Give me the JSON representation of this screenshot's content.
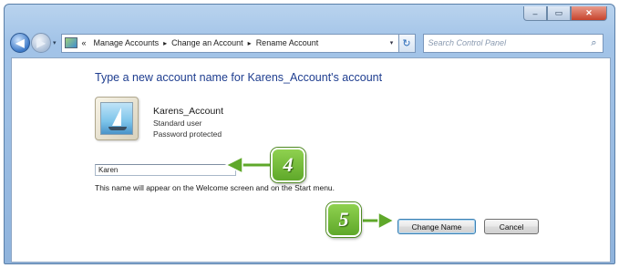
{
  "window": {
    "title_controls": {
      "minimize": "–",
      "maximize": "▭",
      "close": "✕"
    }
  },
  "navbar": {
    "back": "◀",
    "forward": "▶",
    "history_drop": "▾",
    "breadcrumb_lead": "«",
    "breadcrumbs": [
      "Manage Accounts",
      "Change an Account",
      "Rename Account"
    ],
    "separator": "▸",
    "address_drop": "▾",
    "refresh": "↻",
    "search_placeholder": "Search Control Panel",
    "search_icon": "⌕"
  },
  "content": {
    "heading": "Type a new account name for Karens_Account's account",
    "account": {
      "name": "Karens_Account",
      "type": "Standard user",
      "password_status": "Password protected"
    },
    "new_name_value": "Karen",
    "helper_text": "This name will appear on the Welcome screen and on the Start menu.",
    "buttons": {
      "change_name": "Change Name",
      "cancel": "Cancel"
    }
  },
  "callouts": {
    "step4": "4",
    "step5": "5"
  },
  "colors": {
    "callout_green": "#6db536",
    "heading_blue": "#1e3d8f"
  }
}
